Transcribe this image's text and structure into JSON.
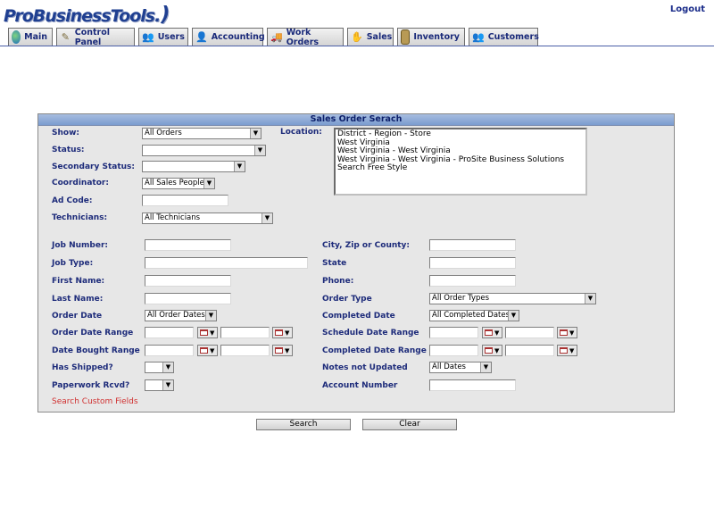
{
  "header": {
    "logo_text": "ProBusinessTools.",
    "logo_paren": ")",
    "logout_label": "Logout"
  },
  "tabs": [
    {
      "label": "Main",
      "icon": "globe-icon"
    },
    {
      "label": "Control Panel",
      "icon": "tools-icon"
    },
    {
      "label": "Users",
      "icon": "users-icon"
    },
    {
      "label": "Accounting",
      "icon": "accountant-icon"
    },
    {
      "label": "Work Orders",
      "icon": "truck-icon"
    },
    {
      "label": "Sales",
      "icon": "sales-icon"
    },
    {
      "label": "Inventory",
      "icon": "box-icon"
    },
    {
      "label": "Customers",
      "icon": "customers-icon"
    }
  ],
  "form": {
    "title": "Sales Order Serach",
    "show_label": "Show:",
    "show_value": "All Orders",
    "status_label": "Status:",
    "status_value": "",
    "secondary_status_label": "Secondary Status:",
    "secondary_status_value": "",
    "coordinator_label": "Coordinator:",
    "coordinator_value": "All Sales People",
    "ad_code_label": "Ad Code:",
    "technicians_label": "Technicians:",
    "technicians_value": "All Technicians",
    "location_label": "Location:",
    "location_options": [
      "District - Region - Store",
      "West Virginia",
      "West Virginia - West Virginia",
      "West Virginia - West Virginia - ProSite Business Solutions",
      "Search Free Style"
    ],
    "job_number_label": "Job Number:",
    "job_type_label": "Job Type:",
    "first_name_label": "First Name:",
    "last_name_label": "Last Name:",
    "order_date_label": "Order Date",
    "order_date_value": "All Order Dates",
    "order_date_range_label": "Order Date Range",
    "date_bought_range_label": "Date Bought Range",
    "has_shipped_label": "Has Shipped?",
    "paperwork_rcvd_label": "Paperwork Rcvd?",
    "city_zip_county_label": "City, Zip or County:",
    "state_label": "State",
    "phone_label": "Phone:",
    "order_type_label": "Order Type",
    "order_type_value": "All Order Types",
    "completed_date_label": "Completed Date",
    "completed_date_value": "All Completed Dates",
    "schedule_date_range_label": "Schedule Date Range",
    "completed_date_range_label": "Completed Date Range",
    "notes_not_updated_label": "Notes not Updated",
    "notes_not_updated_value": "All Dates",
    "account_number_label": "Account Number",
    "search_custom_fields_label": "Search Custom Fields"
  },
  "buttons": {
    "search_label": "Search",
    "clear_label": "Clear"
  }
}
